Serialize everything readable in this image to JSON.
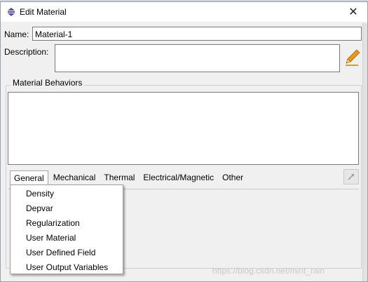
{
  "window": {
    "title": "Edit Material",
    "close_symbol": "✕"
  },
  "form": {
    "name_label": "Name:",
    "name_value": "Material-1",
    "description_label": "Description:",
    "description_value": ""
  },
  "behaviors": {
    "group_label": "Material Behaviors"
  },
  "menubar": {
    "items": [
      {
        "label": "General"
      },
      {
        "label": "Mechanical"
      },
      {
        "label": "Thermal"
      },
      {
        "label": "Electrical/Magnetic"
      },
      {
        "label": "Other"
      }
    ]
  },
  "general_menu": {
    "items": [
      {
        "label": "Density"
      },
      {
        "label": "Depvar"
      },
      {
        "label": "Regularization"
      },
      {
        "label": "User Material"
      },
      {
        "label": "User Defined Field"
      },
      {
        "label": "User Output Variables"
      }
    ]
  },
  "watermark": "https://blog.csdn.net/mint_rain",
  "colors": {
    "accent_purple": "#5a4aa0",
    "pencil_orange": "#e59a1b"
  },
  "icons": {
    "app": "material-app-icon",
    "edit": "pencil-icon",
    "tool": "arrow-tool-icon"
  }
}
